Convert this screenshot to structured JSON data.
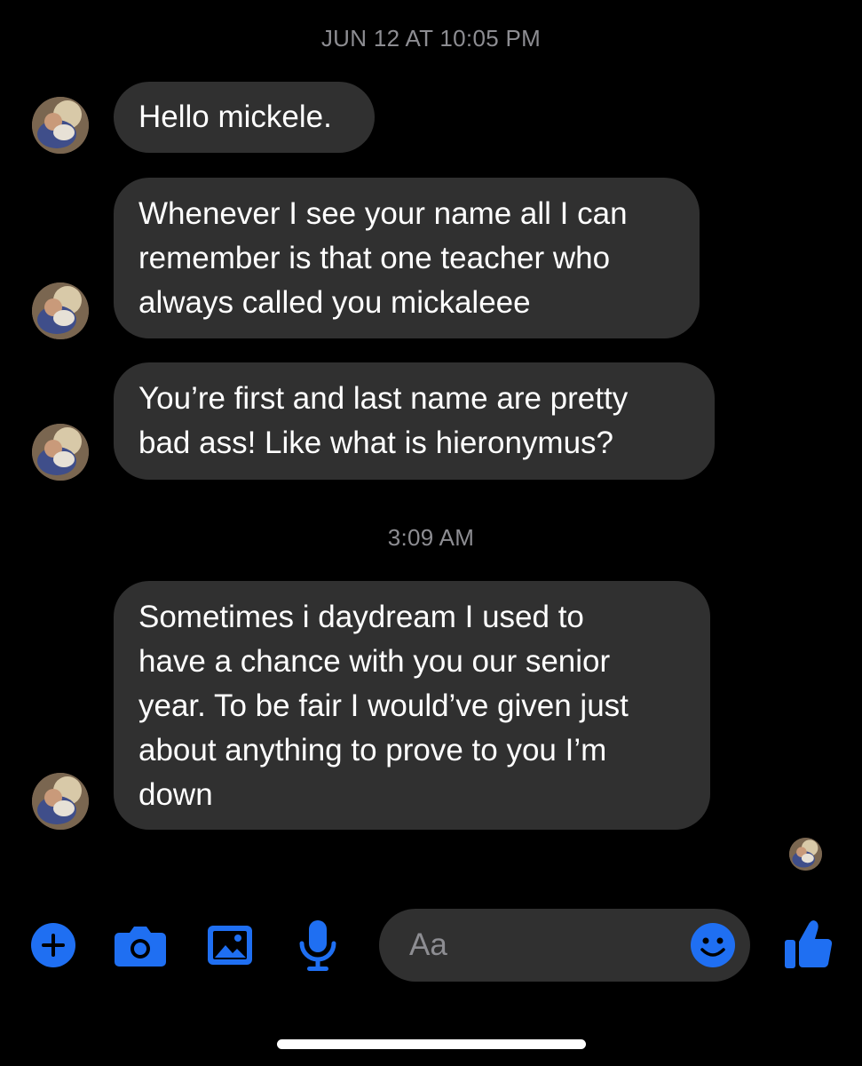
{
  "colors": {
    "background": "#000000",
    "bubble": "#303030",
    "text": "#ffffff",
    "muted": "#8d8d92",
    "accent": "#1f6ff2"
  },
  "timestamps": [
    "JUN 12 AT 10:05 PM",
    "3:09 AM"
  ],
  "messages": [
    {
      "lines": [
        "Hello mickele."
      ]
    },
    {
      "lines": [
        "Whenever I see your name all I can",
        "remember is that one teacher who",
        "always called you mickaleee"
      ]
    },
    {
      "lines": [
        "You’re first and last name are pretty",
        "bad ass! Like what is hieronymus?"
      ]
    },
    {
      "lines": [
        "Sometimes i daydream I used to",
        "have a chance with you our senior",
        "year. To be fair I would’ve given just",
        "about anything to prove to you I’m",
        "down"
      ]
    }
  ],
  "composer": {
    "placeholder": "Aa",
    "icons": [
      "plus-icon",
      "camera-icon",
      "image-icon",
      "microphone-icon",
      "emoji-icon",
      "thumbs-up-icon"
    ]
  }
}
